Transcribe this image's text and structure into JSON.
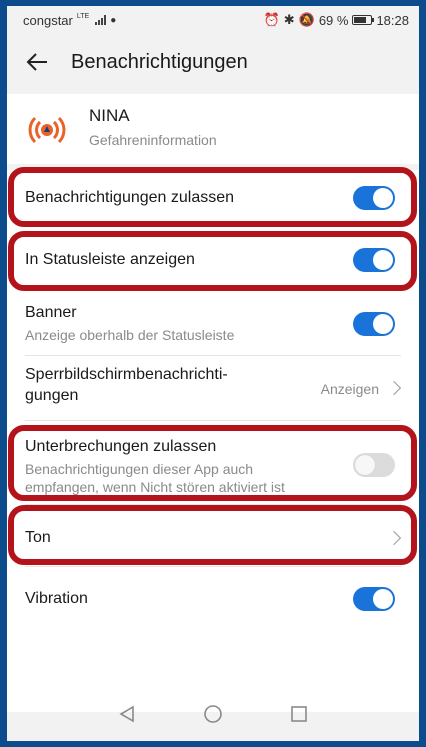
{
  "statusbar": {
    "carrier": "congstar",
    "network": "LTE",
    "battery_percent": "69 %",
    "time": "18:28"
  },
  "appbar": {
    "title": "Benachrichtigungen"
  },
  "app": {
    "name": "NINA",
    "subtitle": "Gefahreninformation"
  },
  "settings": {
    "allow": {
      "label": "Benachrichtigungen zulassen",
      "on": true
    },
    "statusbar": {
      "label": "In Statusleiste anzeigen",
      "on": true
    },
    "banner": {
      "label": "Banner",
      "sub": "Anzeige oberhalb der Statusleiste",
      "on": true
    },
    "lockscreen": {
      "label_line1": "Sperrbildschirmbenachrichti-",
      "label_line2": "gungen",
      "value": "Anzeigen"
    },
    "interrupt": {
      "label": "Unterbrechungen zulassen",
      "sub_line1": "Benachrichtigungen dieser App auch",
      "sub_line2": "empfangen, wenn Nicht stören aktiviert ist",
      "on": false
    },
    "sound": {
      "label": "Ton"
    },
    "vibration": {
      "label": "Vibration",
      "on": true
    }
  },
  "colors": {
    "accent": "#1a73d9",
    "highlight": "#b3141b",
    "frame": "#0d4c8c"
  }
}
